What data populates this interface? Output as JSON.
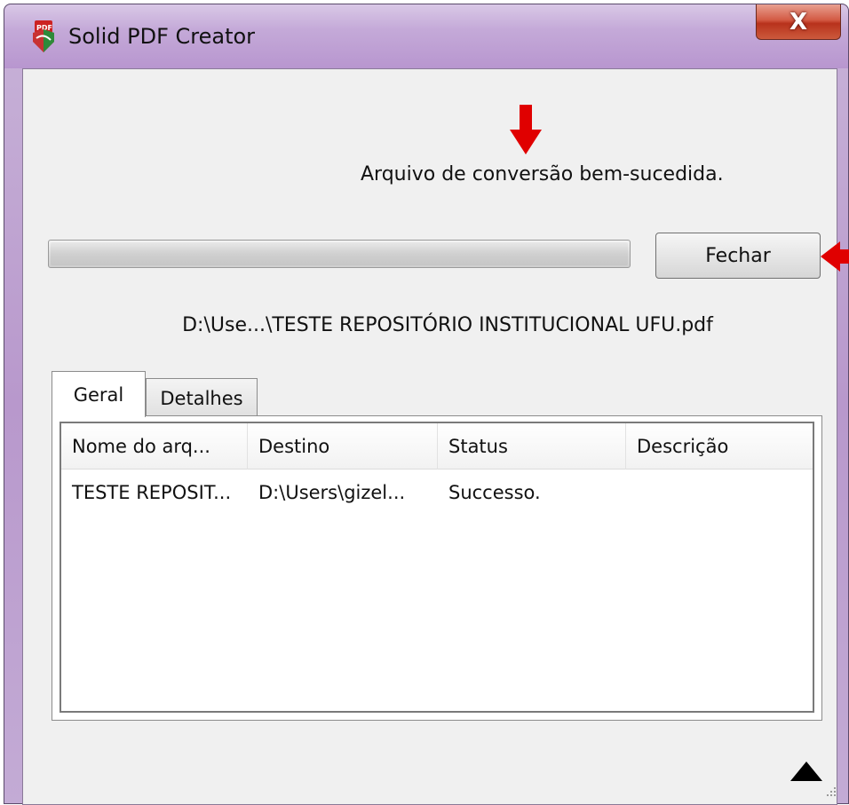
{
  "window": {
    "title": "Solid PDF Creator",
    "close_label": "X"
  },
  "status": {
    "message": "Arquivo de conversão bem-sucedida.",
    "progress": 1.0
  },
  "actions": {
    "close_button": "Fechar"
  },
  "file": {
    "path": "D:\\Use...\\TESTE REPOSITÓRIO INSTITUCIONAL UFU.pdf"
  },
  "tabs": [
    {
      "label": "Geral"
    },
    {
      "label": "Detalhes"
    }
  ],
  "table": {
    "columns": [
      "Nome do arq...",
      "Destino",
      "Status",
      "Descrição"
    ],
    "rows": [
      [
        "TESTE REPOSIT...",
        "D:\\Users\\gizel...",
        "Successo.",
        ""
      ]
    ]
  },
  "colors": {
    "annotation_arrow": "#e00000",
    "accent_titlebar": "#b896cf"
  },
  "icons": {
    "app": "pdf-app-icon",
    "annotation_down": "red-arrow-down-icon",
    "annotation_left": "red-arrow-left-icon",
    "collapse": "triangle-up-icon",
    "grip": "resize-grip-icon"
  }
}
